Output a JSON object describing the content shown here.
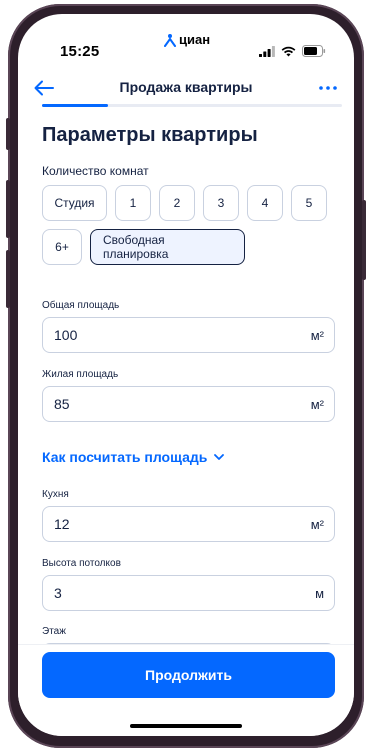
{
  "status": {
    "time": "15:25",
    "logo_text": "циан"
  },
  "header": {
    "title": "Продажа квартиры",
    "progress": 0.22
  },
  "page": {
    "title": "Параметры квартиры",
    "rooms_label": "Количество комнат",
    "rooms_options": [
      "Студия",
      "1",
      "2",
      "3",
      "4",
      "5",
      "6+",
      "Свободная планировка"
    ],
    "rooms_selected": "Свободная планировка"
  },
  "fields": {
    "total_area": {
      "label": "Общая площадь",
      "value": "100",
      "unit": "м²"
    },
    "living_area": {
      "label": "Жилая площадь",
      "value": "85",
      "unit": "м²"
    },
    "calc_link": "Как посчитать площадь",
    "kitchen": {
      "label": "Кухня",
      "value": "12",
      "unit": "м²"
    },
    "ceiling": {
      "label": "Высота потолков",
      "value": "3",
      "unit": "м"
    },
    "floor": {
      "label": "Этаж",
      "value": ""
    }
  },
  "footer": {
    "continue_label": "Продолжить"
  },
  "colors": {
    "accent": "#0468ff",
    "text": "#152242",
    "border": "#c9d1e0",
    "selected_bg": "#eef3ff"
  }
}
